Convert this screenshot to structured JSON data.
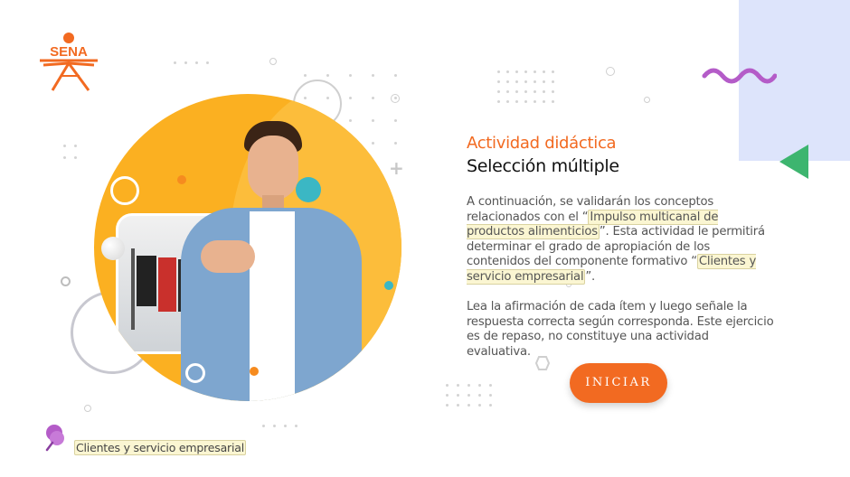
{
  "brand": {
    "logo_text": "SENA",
    "color": "#f26a21"
  },
  "activity": {
    "subtitle": "Actividad didáctica",
    "title": "Selección múltiple",
    "p1_a": "A continuación, se validarán los conceptos relacionados con el “",
    "p1_hl1": "Impulso multicanal de productos alimenticios",
    "p1_b": "”.  Esta actividad le permitirá determinar el grado de apropiación de los contenidos del componente formativo “",
    "p1_hl2": "Clientes y servicio empresarial",
    "p1_c": "”.",
    "p2": "Lea la afirmación de cada ítem y luego señale la respuesta correcta según corresponda.  Este ejercicio es de repaso, no constituye una actividad evaluativa."
  },
  "start_button": {
    "label": "INICIAR",
    "color": "#f26a21"
  },
  "footer": {
    "component_label": "Clientes y servicio empresarial",
    "icon": "pushpin-icon"
  },
  "colors": {
    "accent_orange": "#f26a21",
    "circle_yellow": "#fbb021",
    "panel_lavender": "#dde4fb",
    "triangle_green": "#3db56f",
    "wave_purple": "#b45cc8"
  }
}
